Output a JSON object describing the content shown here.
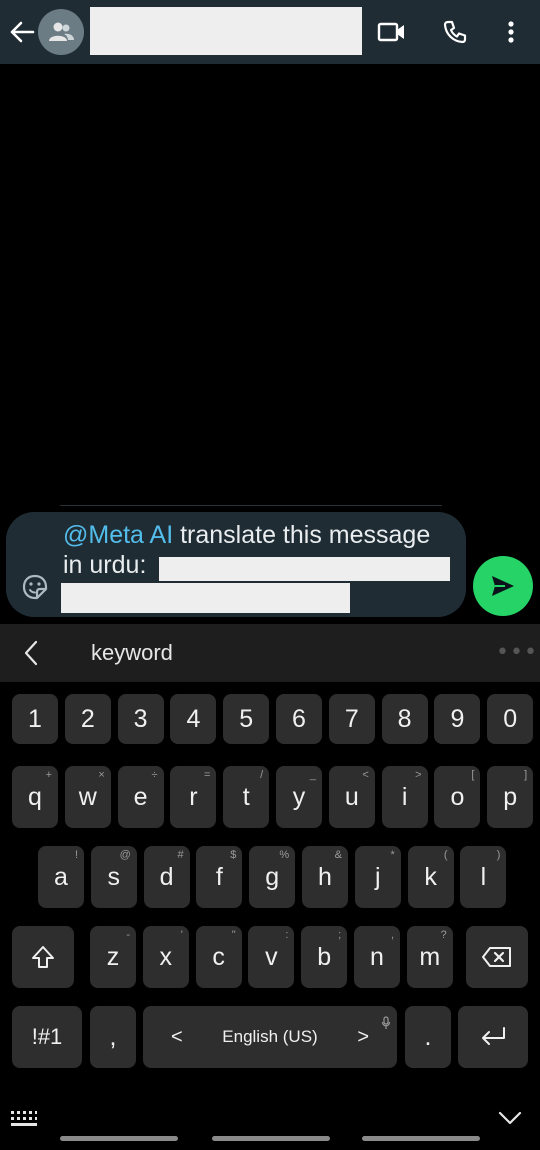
{
  "header": {
    "icons": [
      "back-arrow-icon",
      "group-avatar-icon",
      "video-call-icon",
      "voice-call-icon",
      "more-vert-icon"
    ]
  },
  "composer": {
    "mention": "@Meta AI",
    "message_line1": " translate this message",
    "message_line2": "in urdu:",
    "icons": [
      "sticker-icon",
      "send-icon"
    ]
  },
  "keyboard": {
    "toolbar_text": "keyword",
    "toolbar_more": "•••",
    "row_numbers": [
      "1",
      "2",
      "3",
      "4",
      "5",
      "6",
      "7",
      "8",
      "9",
      "0"
    ],
    "row1": [
      {
        "k": "q",
        "h": "+"
      },
      {
        "k": "w",
        "h": "×"
      },
      {
        "k": "e",
        "h": "÷"
      },
      {
        "k": "r",
        "h": "="
      },
      {
        "k": "t",
        "h": "/"
      },
      {
        "k": "y",
        "h": "_"
      },
      {
        "k": "u",
        "h": "<"
      },
      {
        "k": "i",
        "h": ">"
      },
      {
        "k": "o",
        "h": "["
      },
      {
        "k": "p",
        "h": "]"
      }
    ],
    "row2": [
      {
        "k": "a",
        "h": "!"
      },
      {
        "k": "s",
        "h": "@"
      },
      {
        "k": "d",
        "h": "#"
      },
      {
        "k": "f",
        "h": "$"
      },
      {
        "k": "g",
        "h": "%"
      },
      {
        "k": "h",
        "h": "&"
      },
      {
        "k": "j",
        "h": "*"
      },
      {
        "k": "k",
        "h": "("
      },
      {
        "k": "l",
        "h": ")"
      }
    ],
    "row3": [
      {
        "k": "z",
        "h": "-"
      },
      {
        "k": "x",
        "h": "'"
      },
      {
        "k": "c",
        "h": "\""
      },
      {
        "k": "v",
        "h": ":"
      },
      {
        "k": "b",
        "h": ";"
      },
      {
        "k": "n",
        "h": ","
      },
      {
        "k": "m",
        "h": "?"
      }
    ],
    "symbols_key": "!#1",
    "comma_key": ",",
    "space_label": "English (US)",
    "space_left": "<",
    "space_right": ">",
    "period_key": "."
  }
}
